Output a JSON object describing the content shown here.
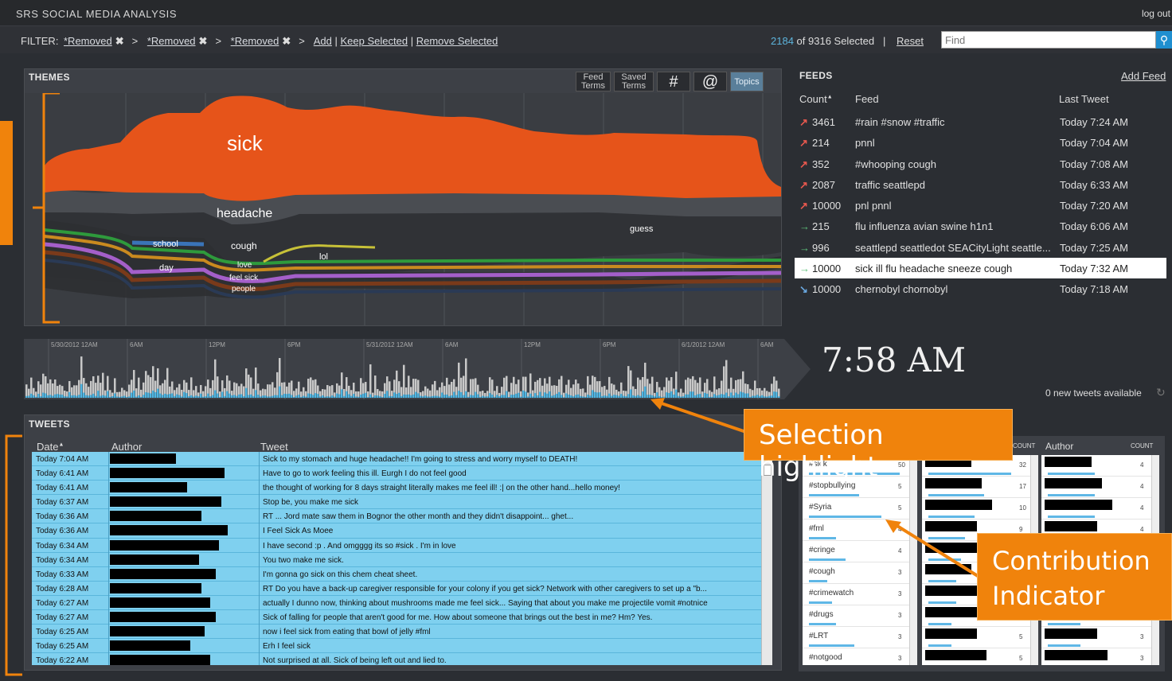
{
  "app": {
    "title": "SRS SOCIAL MEDIA ANALYSIS",
    "logout": "log out"
  },
  "filter": {
    "label": "FILTER:",
    "chips": [
      "*Removed",
      "*Removed",
      "*Removed"
    ],
    "add": "Add",
    "keep": "Keep Selected",
    "remove": "Remove Selected",
    "selected_num": "2184",
    "selected_rest": "of 9316 Selected",
    "divider": "|",
    "reset": "Reset",
    "search_placeholder": "Find"
  },
  "themes": {
    "title": "THEMES",
    "tools": {
      "feed_terms": "Feed Terms",
      "saved_terms": "Saved Terms",
      "hash": "#",
      "at": "@",
      "topics": "Topics"
    },
    "labels": {
      "sick": "sick",
      "headache": "headache",
      "school": "school",
      "cough": "cough",
      "day": "day",
      "love": "love",
      "feel_sick": "feel sick",
      "people": "people",
      "lol": "lol",
      "guess": "guess"
    },
    "colors": {
      "sick": "#e6541a",
      "love": "#2e9a3c",
      "feel_sick": "#c98a1f",
      "people": "#a45fc9"
    }
  },
  "timeline": {
    "ticks": [
      "5/30/2012 12AM",
      "6AM",
      "12PM",
      "6PM",
      "5/31/2012 12AM",
      "6AM",
      "12PM",
      "6PM",
      "6/1/2012 12AM",
      "6AM"
    ]
  },
  "clock": {
    "time": "7:58 AM",
    "new_tweets": "0 new tweets available"
  },
  "feeds": {
    "title": "FEEDS",
    "add": "Add Feed",
    "headers": {
      "count": "Count",
      "feed": "Feed",
      "last": "Last Tweet"
    },
    "rows": [
      {
        "trend": "up",
        "count": "3461",
        "feed": "#rain #snow #traffic",
        "last": "Today 7:24 AM"
      },
      {
        "trend": "up",
        "count": "214",
        "feed": "pnnl",
        "last": "Today 7:04 AM"
      },
      {
        "trend": "up",
        "count": "352",
        "feed": "#whooping cough",
        "last": "Today 7:08 AM"
      },
      {
        "trend": "up",
        "count": "2087",
        "feed": "traffic seattlepd",
        "last": "Today 6:33 AM"
      },
      {
        "trend": "up",
        "count": "10000",
        "feed": "pnl pnnl",
        "last": "Today 7:20 AM"
      },
      {
        "trend": "right",
        "count": "215",
        "feed": "flu influenza avian swine h1n1",
        "last": "Today 6:06 AM"
      },
      {
        "trend": "right",
        "count": "996",
        "feed": "seattlepd seattledot SEACityLight seattle...",
        "last": "Today 7:25 AM"
      },
      {
        "trend": "right",
        "count": "10000",
        "feed": "sick ill flu headache sneeze cough",
        "last": "Today 7:32 AM",
        "selected": true
      },
      {
        "trend": "down",
        "count": "10000",
        "feed": "chernobyl chornobyl",
        "last": "Today 7:18 AM"
      }
    ]
  },
  "tweets": {
    "title": "TWEETS",
    "headers": {
      "date": "Date",
      "author": "Author",
      "tweet": "Tweet"
    },
    "rows": [
      {
        "date": "Today 7:04 AM",
        "w": 0.46,
        "text": "Sick to my stomach and huge headache!! I'm going to stress and worry myself to DEATH!"
      },
      {
        "date": "Today 6:41 AM",
        "w": 0.8,
        "text": "Have to go to work feeling this ill. Eurgh I do not feel good"
      },
      {
        "date": "Today 6:41 AM",
        "w": 0.54,
        "text": "the thought of working for 8 days straight literally makes me feel ill! :| on the other hand...hello money!"
      },
      {
        "date": "Today 6:37 AM",
        "w": 0.78,
        "text": "Stop be, you make me sick"
      },
      {
        "date": "Today 6:36 AM",
        "w": 0.64,
        "text": "RT ... Jord mate saw them in Bognor the other month and they didn't disappoint... ghet..."
      },
      {
        "date": "Today 6:36 AM",
        "w": 0.82,
        "text": "I Feel Sick As Moee"
      },
      {
        "date": "Today 6:34 AM",
        "w": 0.76,
        "text": "I have second :p . And omgggg its so #sick . I'm in love"
      },
      {
        "date": "Today 6:34 AM",
        "w": 0.62,
        "text": "You two make me sick."
      },
      {
        "date": "Today 6:33 AM",
        "w": 0.74,
        "text": "I'm gonna go sick on this chem cheat sheet."
      },
      {
        "date": "Today 6:28 AM",
        "w": 0.64,
        "text": "RT Do you have a back-up caregiver responsible for your colony if you get sick? Network with other caregivers to set up a \"b..."
      },
      {
        "date": "Today 6:27 AM",
        "w": 0.7,
        "text": "actually I dunno now, thinking about mushrooms made me feel sick... Saying that about you make me projectile vomit #notnice"
      },
      {
        "date": "Today 6:27 AM",
        "w": 0.74,
        "text": "Sick of falling for people that aren't good for me. How about someone that brings out the best in me? Hm? Yes."
      },
      {
        "date": "Today 6:25 AM",
        "w": 0.66,
        "text": "now i feel sick from eating that bowl of jelly #fml"
      },
      {
        "date": "Today 6:25 AM",
        "w": 0.56,
        "text": "Erh I feel sick"
      },
      {
        "date": "Today 6:22 AM",
        "w": 0.7,
        "text": "Not surprised at all. Sick of being left out and lied to."
      }
    ]
  },
  "contrib": {
    "count_label": "COUNT",
    "author_label": "Author",
    "hashtags": [
      {
        "tag": "#sick",
        "n": "50",
        "frac": 1.0
      },
      {
        "tag": "#stopbullying",
        "n": "5",
        "frac": 0.55
      },
      {
        "tag": "#Syria",
        "n": "5",
        "frac": 0.8
      },
      {
        "tag": "#fml",
        "n": "4",
        "frac": 0.3
      },
      {
        "tag": "#cringe",
        "n": "4",
        "frac": 0.4
      },
      {
        "tag": "#cough",
        "n": "3",
        "frac": 0.2
      },
      {
        "tag": "#crimewatch",
        "n": "3",
        "frac": 0.25
      },
      {
        "tag": "#drugs",
        "n": "3",
        "frac": 0.3
      },
      {
        "tag": "#LRT",
        "n": "3",
        "frac": 0.5
      },
      {
        "tag": "#notgood",
        "n": "3",
        "frac": 0.2
      }
    ],
    "mentions": [
      {
        "n": "32",
        "frac": 0.9
      },
      {
        "n": "17",
        "frac": 0.6
      },
      {
        "n": "10",
        "frac": 0.5
      },
      {
        "n": "9",
        "frac": 0.4
      },
      {
        "n": "",
        "frac": 0.35
      },
      {
        "n": "",
        "frac": 0.3
      },
      {
        "n": "",
        "frac": 0.3
      },
      {
        "n": "",
        "frac": 0.25
      },
      {
        "n": "5",
        "frac": 0.25
      },
      {
        "n": "5",
        "frac": 0.2
      }
    ],
    "authors": [
      {
        "n": "4",
        "frac": 0.5
      },
      {
        "n": "4",
        "frac": 0.5
      },
      {
        "n": "4",
        "frac": 0.5
      },
      {
        "n": "4",
        "frac": 0.45
      },
      {
        "n": "",
        "frac": 0.45
      },
      {
        "n": "",
        "frac": 0.4
      },
      {
        "n": "",
        "frac": 0.4
      },
      {
        "n": "",
        "frac": 0.35
      },
      {
        "n": "3",
        "frac": 0.35
      },
      {
        "n": "3",
        "frac": 0.3
      }
    ]
  },
  "callouts": {
    "selection": "Selection highlight",
    "contribution": "Contribution Indicator"
  }
}
